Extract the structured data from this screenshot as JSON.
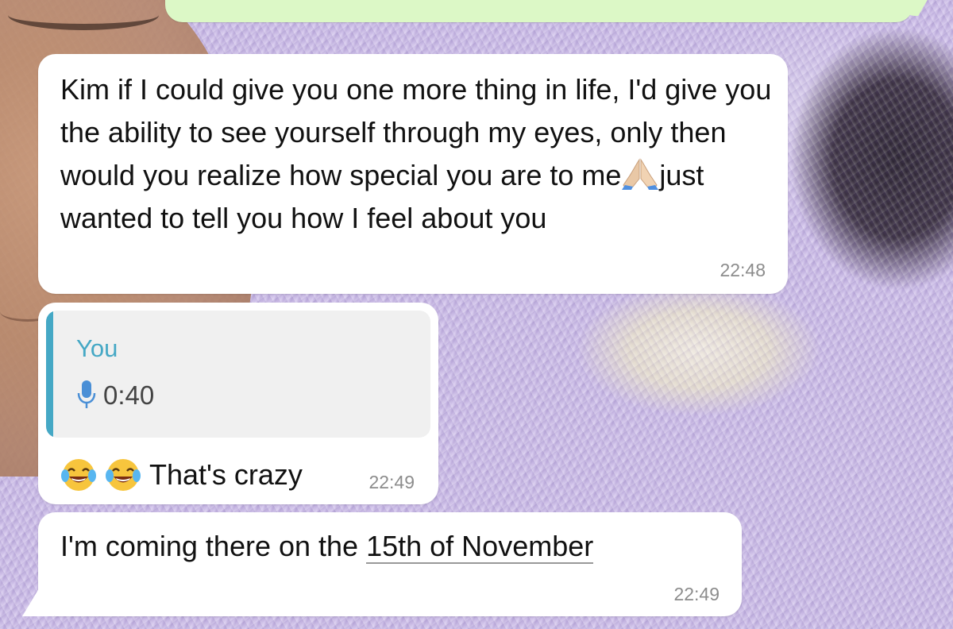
{
  "messages": [
    {
      "text_before_emoji": "Kim if I could give you one more thing in life, I'd give you the ability to see yourself through my eyes, only then would you realize how special you are to me",
      "emoji": "folded-hands-icon",
      "text_after_emoji": "just wanted to tell you how I feel about you",
      "time": "22:48"
    },
    {
      "quoted": {
        "author": "You",
        "icon": "microphone-icon",
        "duration": "0:40"
      },
      "emojis": [
        "face-with-tears-of-joy-icon",
        "face-with-tears-of-joy-icon"
      ],
      "text": "That's crazy",
      "time": "22:49"
    },
    {
      "text_before_link": "I'm coming there on the ",
      "link": "15th of November",
      "time": "22:49"
    }
  ],
  "colors": {
    "outgoing_bubble": "#dcf8c6",
    "incoming_bubble": "#ffffff",
    "quote_accent": "#45a8c5",
    "timestamp": "#8c8c8c"
  }
}
